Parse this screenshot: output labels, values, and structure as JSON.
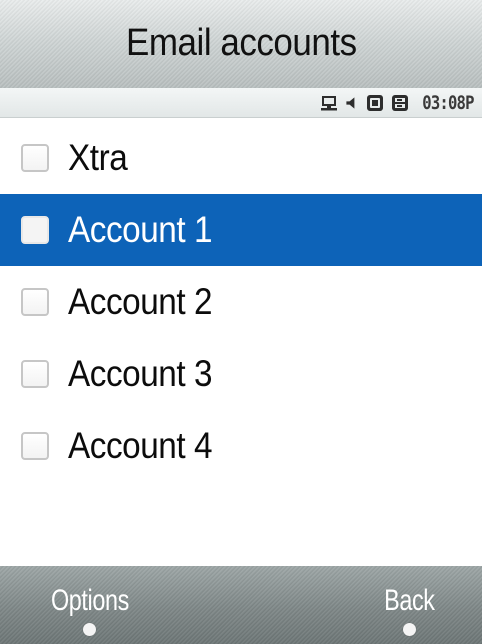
{
  "header": {
    "title": "Email accounts"
  },
  "status_bar": {
    "icons": [
      "pc-sync-icon",
      "speaker-icon",
      "r-network-icon",
      "bluetooth-b-icon"
    ],
    "time": "03:08P"
  },
  "accounts": {
    "selected_index": 1,
    "items": [
      {
        "label": "Xtra",
        "checked": false
      },
      {
        "label": "Account 1",
        "checked": false
      },
      {
        "label": "Account 2",
        "checked": false
      },
      {
        "label": "Account 3",
        "checked": false
      },
      {
        "label": "Account 4",
        "checked": false
      }
    ]
  },
  "softkeys": {
    "left_label": "Options",
    "right_label": "Back"
  },
  "colors": {
    "selection": "#0d63b8",
    "title_bar": "#cfd5d5",
    "softkey_bar": "#7f8888"
  }
}
